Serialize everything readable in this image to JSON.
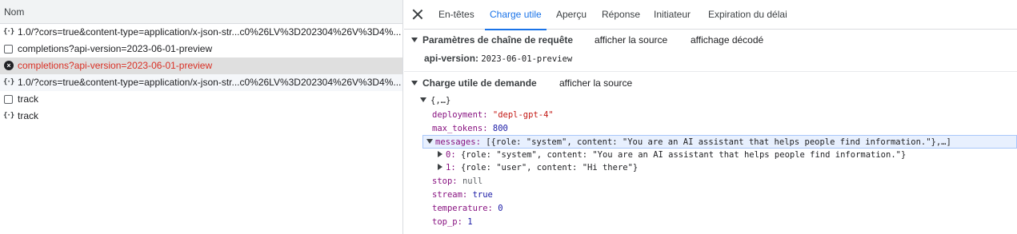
{
  "requests": {
    "header": "Nom",
    "rows": [
      {
        "icon": "json-icon",
        "name": "1.0/?cors=true&content-type=application/x-json-str...c0%26LV%3D202304%26V%3D4%...",
        "state": "normal"
      },
      {
        "icon": "document-icon",
        "name": "completions?api-version=2023-06-01-preview",
        "state": "normal"
      },
      {
        "icon": "error-icon",
        "name": "completions?api-version=2023-06-01-preview",
        "state": "selected-error"
      },
      {
        "icon": "json-icon",
        "name": "1.0/?cors=true&content-type=application/x-json-str...c0%26LV%3D202304%26V%3D4%...",
        "state": "normal"
      },
      {
        "icon": "document-icon",
        "name": "track",
        "state": "normal"
      },
      {
        "icon": "json-icon",
        "name": "track",
        "state": "normal"
      }
    ]
  },
  "tabs": [
    "En-têtes",
    "Charge utile",
    "Aperçu",
    "Réponse",
    "Initiateur",
    "Expiration du délai"
  ],
  "active_tab": "Charge utile",
  "query_section": {
    "title": "Paramètres de chaîne de requête",
    "link_source": "afficher la source",
    "link_decoded": "affichage décodé",
    "param_key": "api-version:",
    "param_value": "2023-06-01-preview"
  },
  "payload_section": {
    "title": "Charge utile de demande",
    "link_source": "afficher la source",
    "root": "{,…}",
    "deployment_key": "deployment:",
    "deployment_value": "\"depl-gpt-4\"",
    "max_tokens_key": "max_tokens:",
    "max_tokens_value": "800",
    "messages_key": "messages:",
    "messages_value": "[{role: \"system\", content: \"You are an AI assistant that helps people find information.\"},…]",
    "msg0_key": "0:",
    "msg0_value": "{role: \"system\", content: \"You are an AI assistant that helps people find information.\"}",
    "msg1_key": "1:",
    "msg1_value": "{role: \"user\", content: \"Hi there\"}",
    "stop_key": "stop:",
    "stop_value": "null",
    "stream_key": "stream:",
    "stream_value": "true",
    "temperature_key": "temperature:",
    "temperature_value": "0",
    "top_p_key": "top_p:",
    "top_p_value": "1"
  },
  "colors": {
    "accent": "#1a73e8",
    "error": "#d93025",
    "key": "#c80000",
    "string": "#c41a16",
    "number": "#1a1aa6",
    "selected_row": "#dfdfdf"
  }
}
